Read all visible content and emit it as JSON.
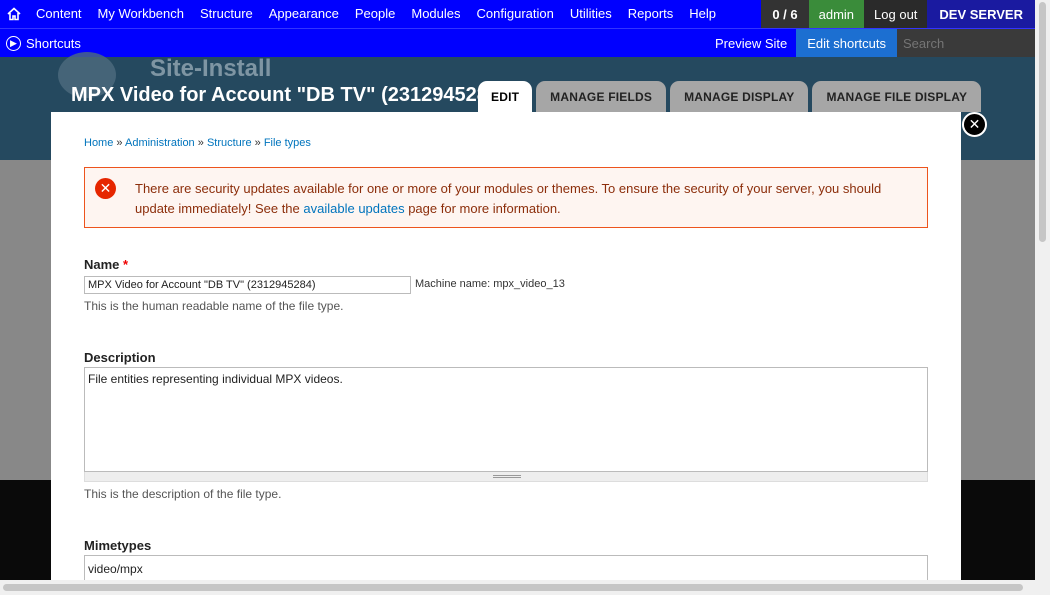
{
  "toolbar": {
    "menu": [
      "Content",
      "My Workbench",
      "Structure",
      "Appearance",
      "People",
      "Modules",
      "Configuration",
      "Utilities",
      "Reports",
      "Help"
    ],
    "counter": "0 / 6",
    "user": "admin",
    "logout": "Log out",
    "server": "DEV SERVER",
    "shortcuts": "Shortcuts",
    "preview_site": "Preview Site",
    "edit_shortcuts": "Edit shortcuts",
    "search_placeholder": "Search"
  },
  "header": {
    "site_name": "Site-Install",
    "page_title": "MPX Video for Account \"DB TV\" (2312945284)"
  },
  "tabs": [
    "EDIT",
    "MANAGE FIELDS",
    "MANAGE DISPLAY",
    "MANAGE FILE DISPLAY"
  ],
  "breadcrumb": {
    "home": "Home",
    "administration": "Administration",
    "structure": "Structure",
    "file_types": "File types",
    "separator": "»"
  },
  "alert": {
    "text_before": "There are security updates available for one or more of your modules or themes. To ensure the security of your server, you should update immediately! See the ",
    "link": "available updates",
    "text_after": " page for more information."
  },
  "form": {
    "name_label": "Name",
    "required_mark": "*",
    "name_value": "MPX Video for Account \"DB TV\" (2312945284)",
    "machine_name": "Machine name: mpx_video_13",
    "name_desc": "This is the human readable name of the file type.",
    "description_label": "Description",
    "description_value": "File entities representing individual MPX videos.",
    "description_desc": "This is the description of the file type.",
    "mimetypes_label": "Mimetypes",
    "mimetypes_value": "video/mpx"
  },
  "colors": {
    "toolbar": "#0000ff",
    "header_bg": "#25495f",
    "alert_border": "#ed541d",
    "link": "#0074bd"
  }
}
